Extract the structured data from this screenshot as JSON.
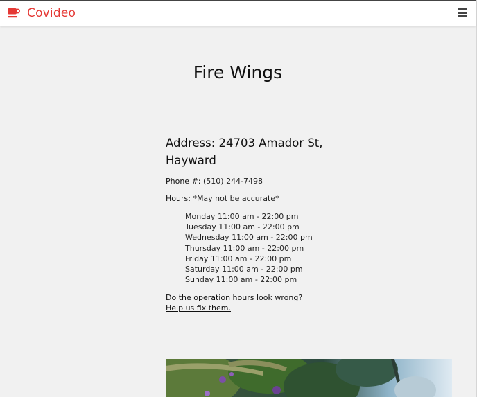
{
  "brand": {
    "name": "Covideo",
    "icon": "coffee-cup-icon",
    "color": "#e53935"
  },
  "menu": {
    "icon": "hamburger-menu-icon"
  },
  "restaurant": {
    "name": "Fire Wings",
    "address": "Address: 24703 Amador St, Hayward",
    "phone_label": "Phone #:",
    "phone": "(510) 244-7498",
    "hours_label": "Hours:",
    "hours_note": "*May not be accurate*",
    "hours": [
      {
        "day": "Monday",
        "time": "11:00 am - 22:00 pm"
      },
      {
        "day": "Tuesday",
        "time": "11:00 am - 22:00 pm"
      },
      {
        "day": "Wednesday",
        "time": "11:00 am - 22:00 pm"
      },
      {
        "day": "Thursday",
        "time": "11:00 am - 22:00 pm"
      },
      {
        "day": "Friday",
        "time": "11:00 am - 22:00 pm"
      },
      {
        "day": "Saturday",
        "time": "11:00 am - 22:00 pm"
      },
      {
        "day": "Sunday",
        "time": "11:00 am - 22:00 pm"
      }
    ],
    "fix_link": "Do the operation hours look wrong? Help us fix them."
  }
}
